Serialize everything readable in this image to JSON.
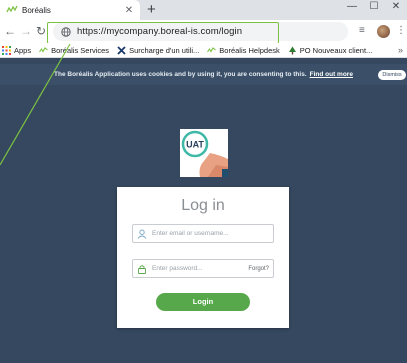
{
  "browser": {
    "tab_title": "Boréalis",
    "tab_close": "✕",
    "new_tab": "+",
    "window_controls": [
      "—",
      "☐",
      "✕"
    ],
    "url": "https://mycompany.boreal-is.com/login",
    "bookmarks": [
      {
        "label": "Apps",
        "icon": "apps-grid-icon"
      },
      {
        "label": "Boréalis Services",
        "icon": "borealis-icon"
      },
      {
        "label": "Surcharge d'un utili...",
        "icon": "x-logo-icon"
      },
      {
        "label": "Boréalis Helpdesk",
        "icon": "borealis-icon"
      },
      {
        "label": "PO Nouveaux client...",
        "icon": "tree-icon"
      }
    ],
    "bookmarks_more": "»"
  },
  "cookie_banner": {
    "message": "The Boréalis Application uses cookies and by using it, you are consenting to this.",
    "link": "Find out more",
    "dismiss": "Dismiss"
  },
  "logo": {
    "text": "UAT"
  },
  "login": {
    "title": "Log in",
    "email_placeholder": "Enter email or username...",
    "password_placeholder": "Enter password...",
    "forgot": "Forgot?",
    "button": "Login"
  },
  "colors": {
    "page_bg": "#35485f",
    "highlight": "#7cc242",
    "login_button": "#57a84a",
    "banner_bg": "#3b5068"
  }
}
